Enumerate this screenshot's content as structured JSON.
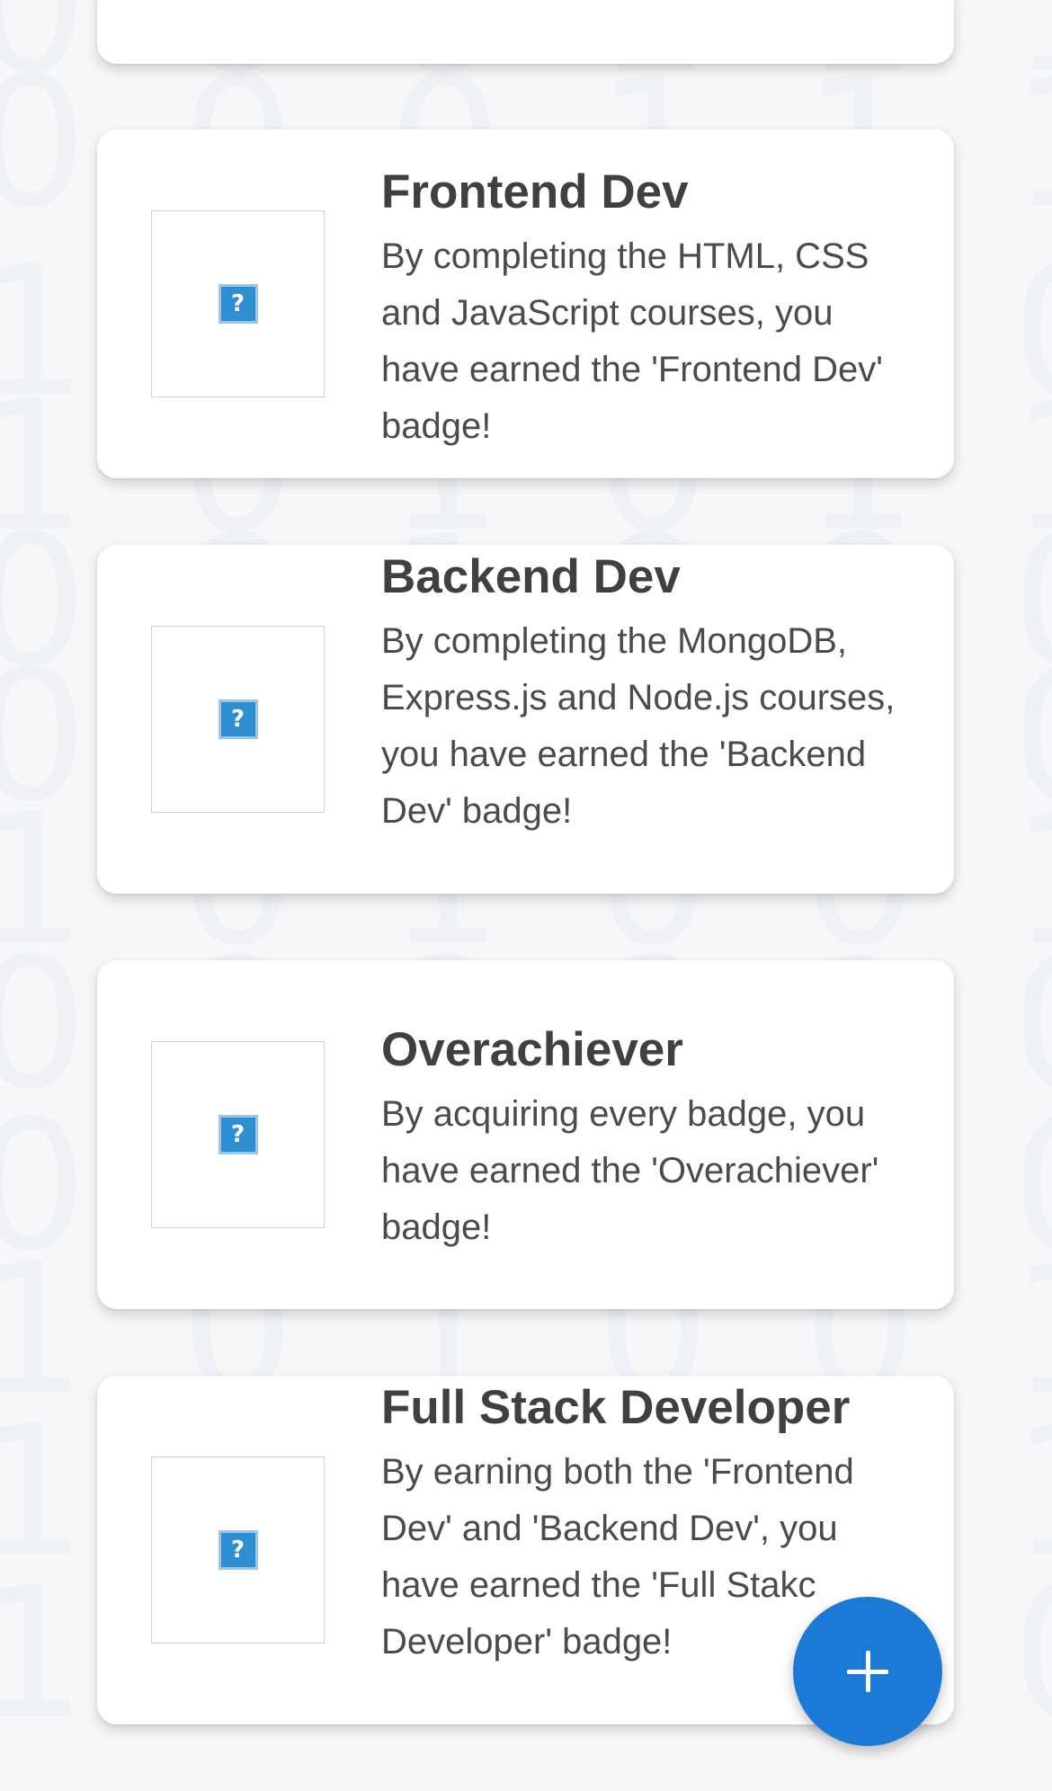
{
  "badges": [
    {
      "title": "Frontend Dev",
      "description": "By completing the HTML, CSS and JavaScript courses, you have earned the 'Frontend Dev' badge!"
    },
    {
      "title": "Backend Dev",
      "description": "By completing the MongoDB, Express.js and Node.js courses, you have earned the 'Backend Dev' badge!"
    },
    {
      "title": "Overachiever",
      "description": "By acquiring every badge, you have earned the 'Overachiever' badge!"
    },
    {
      "title": "Full Stack Developer",
      "description": "By earning both the 'Frontend Dev' and 'Backend Dev', you have earned the 'Full Stakc Developer' badge!"
    }
  ],
  "fab": {
    "icon": "plus-icon",
    "color": "#1b7ad6"
  },
  "broken_image_icon": {
    "glyph": "?",
    "icon": "broken-image-icon"
  },
  "colors": {
    "card_background": "#ffffff",
    "page_background": "#f7f7f9",
    "title_text": "#404040",
    "body_text": "#4b4b4b"
  }
}
